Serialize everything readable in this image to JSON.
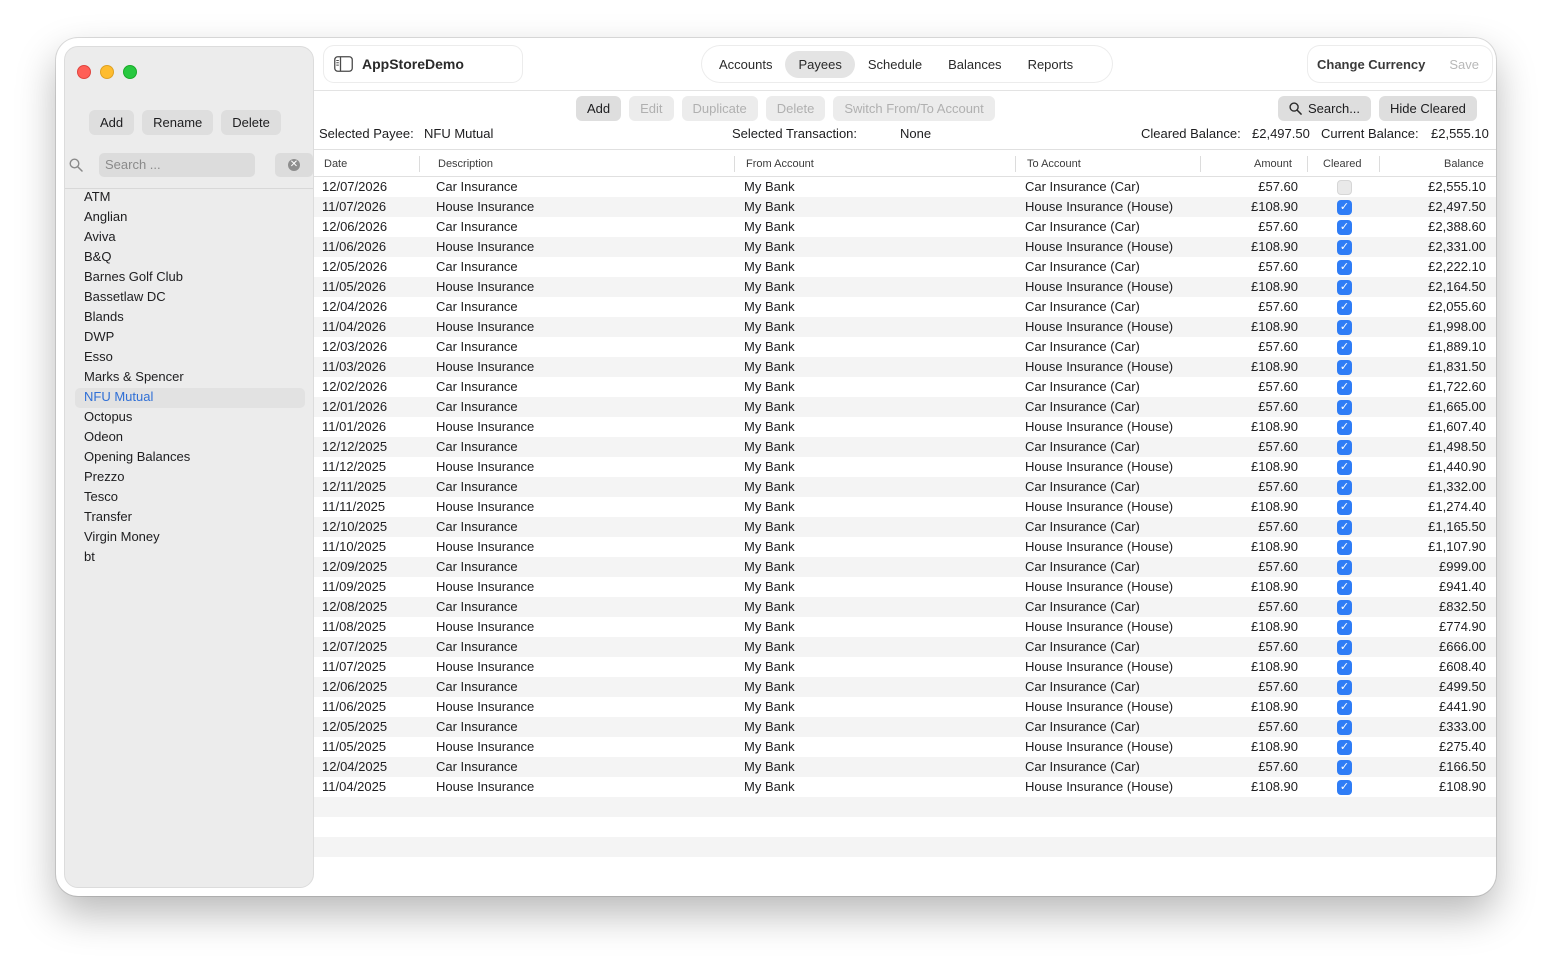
{
  "sidebar": {
    "buttons": {
      "add": "Add",
      "rename": "Rename",
      "delete": "Delete"
    },
    "search": {
      "placeholder": "Search ..."
    },
    "payees": [
      "ATM",
      "Anglian",
      "Aviva",
      "B&Q",
      "Barnes Golf Club",
      "Bassetlaw DC",
      "Blands",
      "DWP",
      "Esso",
      "Marks & Spencer",
      "NFU Mutual",
      "Octopus",
      "Odeon",
      "Opening Balances",
      "Prezzo",
      "Tesco",
      "Transfer",
      "Virgin Money",
      "bt"
    ],
    "selected_payee": "NFU Mutual"
  },
  "header": {
    "app_title": "AppStoreDemo",
    "tabs": [
      "Accounts",
      "Payees",
      "Schedule",
      "Balances",
      "Reports"
    ],
    "active_tab": "Payees",
    "change_currency": "Change Currency",
    "save": "Save"
  },
  "actions": {
    "add": "Add",
    "edit": "Edit",
    "duplicate": "Duplicate",
    "delete": "Delete",
    "switch": "Switch From/To Account",
    "search": "Search...",
    "hide_cleared": "Hide Cleared"
  },
  "info": {
    "selected_payee_label": "Selected Payee:",
    "selected_payee_value": "NFU Mutual",
    "selected_txn_label": "Selected Transaction:",
    "selected_txn_value": "None",
    "cleared_label": "Cleared Balance:",
    "cleared_value": "£2,497.50",
    "current_label": "Current Balance:",
    "current_value": "£2,555.10"
  },
  "table": {
    "columns": [
      "Date",
      "Description",
      "From Account",
      "To Account",
      "Amount",
      "Cleared",
      "Balance"
    ],
    "rows": [
      [
        "12/07/2026",
        "Car Insurance",
        "My Bank",
        "Car Insurance (Car)",
        "£57.60",
        false,
        "£2,555.10"
      ],
      [
        "11/07/2026",
        "House Insurance",
        "My Bank",
        "House Insurance (House)",
        "£108.90",
        true,
        "£2,497.50"
      ],
      [
        "12/06/2026",
        "Car Insurance",
        "My Bank",
        "Car Insurance (Car)",
        "£57.60",
        true,
        "£2,388.60"
      ],
      [
        "11/06/2026",
        "House Insurance",
        "My Bank",
        "House Insurance (House)",
        "£108.90",
        true,
        "£2,331.00"
      ],
      [
        "12/05/2026",
        "Car Insurance",
        "My Bank",
        "Car Insurance (Car)",
        "£57.60",
        true,
        "£2,222.10"
      ],
      [
        "11/05/2026",
        "House Insurance",
        "My Bank",
        "House Insurance (House)",
        "£108.90",
        true,
        "£2,164.50"
      ],
      [
        "12/04/2026",
        "Car Insurance",
        "My Bank",
        "Car Insurance (Car)",
        "£57.60",
        true,
        "£2,055.60"
      ],
      [
        "11/04/2026",
        "House Insurance",
        "My Bank",
        "House Insurance (House)",
        "£108.90",
        true,
        "£1,998.00"
      ],
      [
        "12/03/2026",
        "Car Insurance",
        "My Bank",
        "Car Insurance (Car)",
        "£57.60",
        true,
        "£1,889.10"
      ],
      [
        "11/03/2026",
        "House Insurance",
        "My Bank",
        "House Insurance (House)",
        "£108.90",
        true,
        "£1,831.50"
      ],
      [
        "12/02/2026",
        "Car Insurance",
        "My Bank",
        "Car Insurance (Car)",
        "£57.60",
        true,
        "£1,722.60"
      ],
      [
        "12/01/2026",
        "Car Insurance",
        "My Bank",
        "Car Insurance (Car)",
        "£57.60",
        true,
        "£1,665.00"
      ],
      [
        "11/01/2026",
        "House Insurance",
        "My Bank",
        "House Insurance (House)",
        "£108.90",
        true,
        "£1,607.40"
      ],
      [
        "12/12/2025",
        "Car Insurance",
        "My Bank",
        "Car Insurance (Car)",
        "£57.60",
        true,
        "£1,498.50"
      ],
      [
        "11/12/2025",
        "House Insurance",
        "My Bank",
        "House Insurance (House)",
        "£108.90",
        true,
        "£1,440.90"
      ],
      [
        "12/11/2025",
        "Car Insurance",
        "My Bank",
        "Car Insurance (Car)",
        "£57.60",
        true,
        "£1,332.00"
      ],
      [
        "11/11/2025",
        "House Insurance",
        "My Bank",
        "House Insurance (House)",
        "£108.90",
        true,
        "£1,274.40"
      ],
      [
        "12/10/2025",
        "Car Insurance",
        "My Bank",
        "Car Insurance (Car)",
        "£57.60",
        true,
        "£1,165.50"
      ],
      [
        "11/10/2025",
        "House Insurance",
        "My Bank",
        "House Insurance (House)",
        "£108.90",
        true,
        "£1,107.90"
      ],
      [
        "12/09/2025",
        "Car Insurance",
        "My Bank",
        "Car Insurance (Car)",
        "£57.60",
        true,
        "£999.00"
      ],
      [
        "11/09/2025",
        "House Insurance",
        "My Bank",
        "House Insurance (House)",
        "£108.90",
        true,
        "£941.40"
      ],
      [
        "12/08/2025",
        "Car Insurance",
        "My Bank",
        "Car Insurance (Car)",
        "£57.60",
        true,
        "£832.50"
      ],
      [
        "11/08/2025",
        "House Insurance",
        "My Bank",
        "House Insurance (House)",
        "£108.90",
        true,
        "£774.90"
      ],
      [
        "12/07/2025",
        "Car Insurance",
        "My Bank",
        "Car Insurance (Car)",
        "£57.60",
        true,
        "£666.00"
      ],
      [
        "11/07/2025",
        "House Insurance",
        "My Bank",
        "House Insurance (House)",
        "£108.90",
        true,
        "£608.40"
      ],
      [
        "12/06/2025",
        "Car Insurance",
        "My Bank",
        "Car Insurance (Car)",
        "£57.60",
        true,
        "£499.50"
      ],
      [
        "11/06/2025",
        "House Insurance",
        "My Bank",
        "House Insurance (House)",
        "£108.90",
        true,
        "£441.90"
      ],
      [
        "12/05/2025",
        "Car Insurance",
        "My Bank",
        "Car Insurance (Car)",
        "£57.60",
        true,
        "£333.00"
      ],
      [
        "11/05/2025",
        "House Insurance",
        "My Bank",
        "House Insurance (House)",
        "£108.90",
        true,
        "£275.40"
      ],
      [
        "12/04/2025",
        "Car Insurance",
        "My Bank",
        "Car Insurance (Car)",
        "£57.60",
        true,
        "£166.50"
      ],
      [
        "11/04/2025",
        "House Insurance",
        "My Bank",
        "House Insurance (House)",
        "£108.90",
        true,
        "£108.90"
      ]
    ]
  },
  "colors": {
    "accent": "#2f7df6",
    "selected_text": "#2f6fd6",
    "close": "#ff5f57",
    "minimize": "#febc2e",
    "maximize": "#28c840"
  },
  "icons": {
    "sidebar_toggle": "sidebar-icon",
    "search": "magnifier-icon",
    "clear": "clear-circle-icon",
    "check": "checkmark-icon"
  }
}
